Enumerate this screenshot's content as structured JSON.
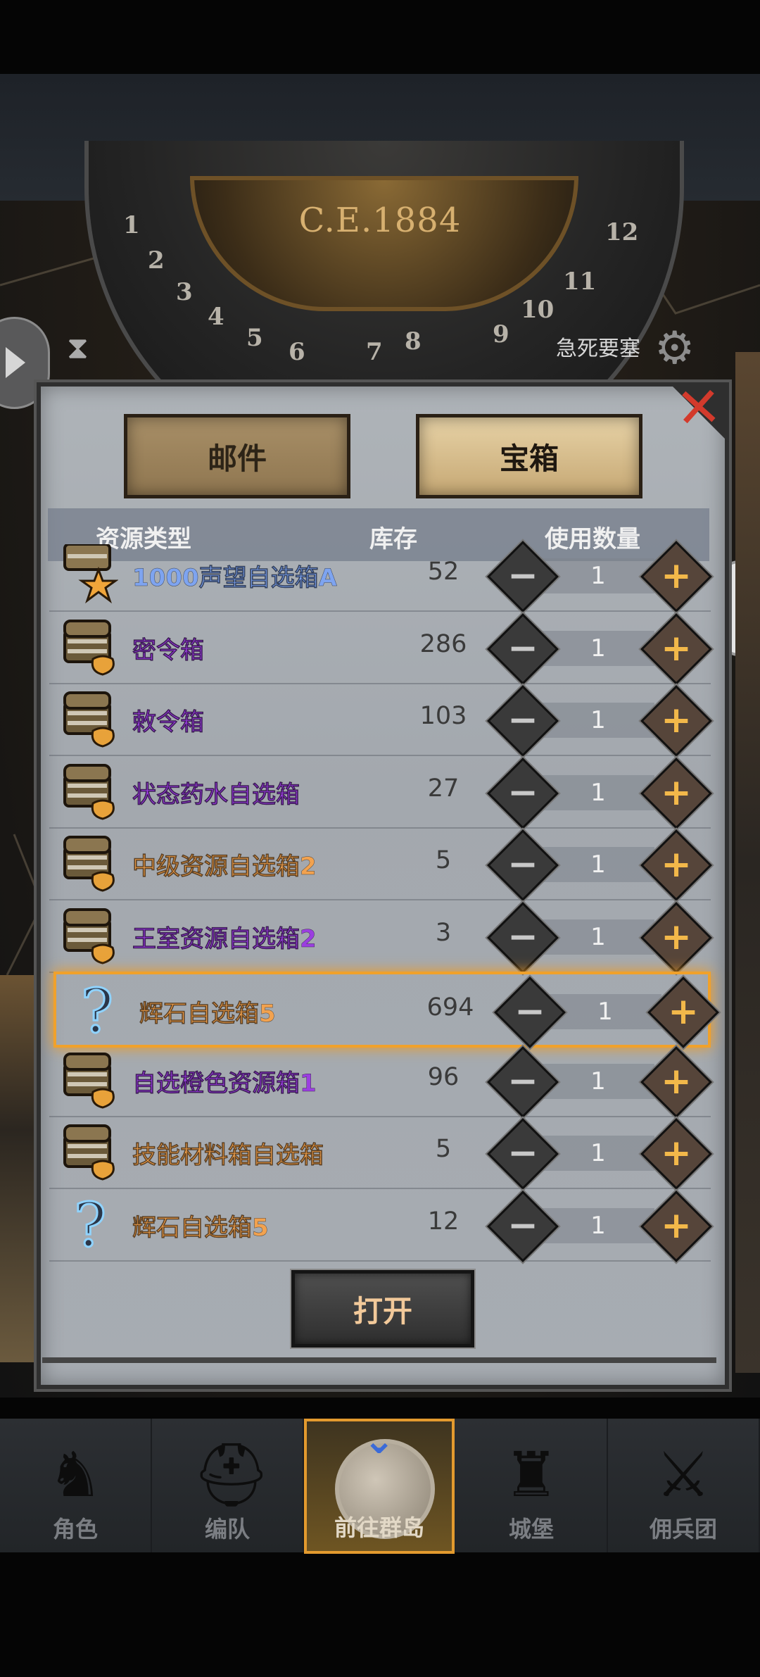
{
  "world": {
    "year": "C.E.1884",
    "place": "急死要塞",
    "dial_numbers": [
      "1",
      "2",
      "3",
      "4",
      "5",
      "6",
      "7",
      "8",
      "9",
      "10",
      "11",
      "12"
    ]
  },
  "tabs": {
    "mail": "邮件",
    "chest": "宝箱",
    "active": "chest"
  },
  "columns": {
    "type": "资源类型",
    "stock": "库存",
    "use_qty": "使用数量"
  },
  "colors": {
    "blue": "#7ea4f0",
    "purple": "#9b3fe0",
    "orange": "#f2a24f",
    "highlight": "#f0a12b"
  },
  "items": [
    {
      "name": "1000声望自选箱A",
      "stock": "52",
      "qty": "1",
      "color": "blue",
      "icon": "chest-star-icon"
    },
    {
      "name": "密令箱",
      "stock": "286",
      "qty": "1",
      "color": "purple",
      "icon": "treasure-chest-icon"
    },
    {
      "name": "敕令箱",
      "stock": "103",
      "qty": "1",
      "color": "purple",
      "icon": "treasure-chest-icon"
    },
    {
      "name": "状态药水自选箱",
      "stock": "27",
      "qty": "1",
      "color": "purple",
      "icon": "treasure-chest-icon"
    },
    {
      "name": "中级资源自选箱2",
      "stock": "5",
      "qty": "1",
      "color": "orange",
      "icon": "treasure-chest-icon"
    },
    {
      "name": "王室资源自选箱2",
      "stock": "3",
      "qty": "1",
      "color": "purple",
      "icon": "treasure-chest-icon"
    },
    {
      "name": "辉石自选箱5",
      "stock": "694",
      "qty": "1",
      "color": "orange",
      "icon": "question-mark-icon",
      "selected": true
    },
    {
      "name": "自选橙色资源箱1",
      "stock": "96",
      "qty": "1",
      "color": "purple",
      "icon": "treasure-chest-icon"
    },
    {
      "name": "技能材料箱自选箱",
      "stock": "5",
      "qty": "1",
      "color": "orange",
      "icon": "treasure-chest-icon"
    },
    {
      "name": "辉石自选箱5",
      "stock": "12",
      "qty": "1",
      "color": "orange",
      "icon": "question-mark-icon"
    }
  ],
  "open_button": "打开",
  "nav": [
    {
      "label": "角色",
      "icon": "knight-icon"
    },
    {
      "label": "编队",
      "icon": "helmet-icon"
    },
    {
      "label": "前往群岛",
      "icon": "globe-icon",
      "active": true
    },
    {
      "label": "城堡",
      "icon": "castle-icon"
    },
    {
      "label": "佣兵团",
      "icon": "mercenary-icon"
    }
  ]
}
